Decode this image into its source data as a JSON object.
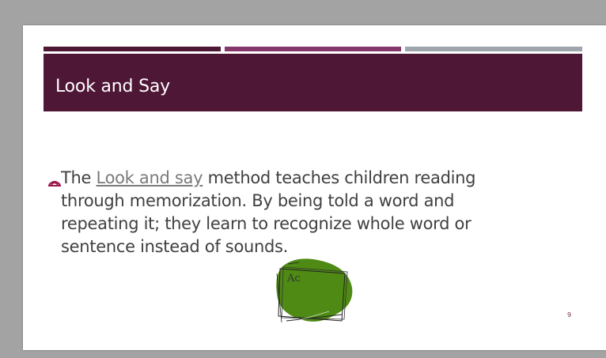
{
  "colors": {
    "background": "#a3a3a3",
    "slide": "#ffffff",
    "bar1": "#4f1736",
    "bar2": "#86376a",
    "bar3": "#9ea5ad",
    "title_band": "#4f1736",
    "title_text": "#ffffff",
    "body_text": "#404040",
    "link_text": "#7a7a7a",
    "accent": "#9b1a4b",
    "sticker_fill": "#4e8a14",
    "page_number": "#7a2a4a"
  },
  "slide": {
    "title": "Look and Say",
    "bullet": {
      "icon": "book-icon",
      "prefix": "The ",
      "link": "Look and say",
      "rest": " method teaches children reading through memorization.  By being told a word and repeating it;  they learn to recognize whole word or sentence instead of sounds."
    },
    "sticker": {
      "icon": "flashcard-sketch-icon",
      "text": "Ac"
    },
    "page_number": "9"
  }
}
